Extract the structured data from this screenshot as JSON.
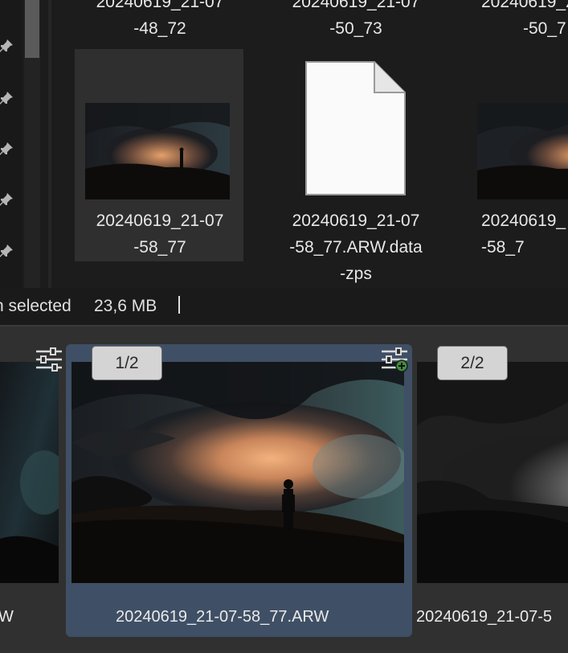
{
  "explorer": {
    "top_row": [
      {
        "line1": "20240619_21-07",
        "line2": "-48_72"
      },
      {
        "line1": "20240619_21-07",
        "line2": "-50_73"
      },
      {
        "line1": "20240619_21-07",
        "line2": "-50_7"
      }
    ],
    "files": [
      {
        "name": "20240619_21-07\n-58_77",
        "type": "image",
        "selected": true
      },
      {
        "name": "20240619_21-07\n-58_77.ARW.data\n-zps",
        "type": "document",
        "selected": false
      },
      {
        "name": "20240619_\n-58_7",
        "type": "image",
        "selected": false
      }
    ]
  },
  "status_bar": {
    "selection_text": "n selected",
    "size_text": "23,6 MB"
  },
  "filmstrip": {
    "items": [
      {
        "label": "W",
        "badge": "",
        "state": "partial-left"
      },
      {
        "label": "20240619_21-07-58_77.ARW",
        "badge": "1/2",
        "state": "selected"
      },
      {
        "label": "20240619_21-07-5",
        "badge": "2/2",
        "state": "partial-right"
      }
    ]
  },
  "icons": {
    "pin": "pin-icon",
    "adjustments": "sliders-icon",
    "adjustments_add": "sliders-add-icon",
    "document": "blank-document-icon"
  },
  "colors": {
    "selection_highlight": "#3f4f65",
    "add_badge_green": "#3f8f3a"
  }
}
